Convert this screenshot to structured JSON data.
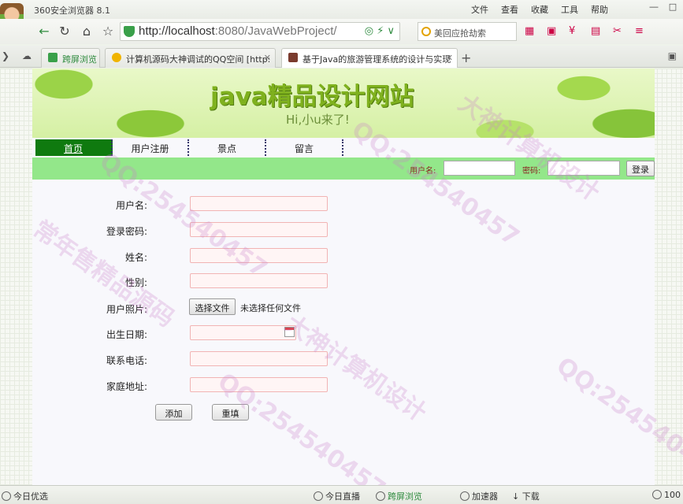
{
  "browser": {
    "title": "360安全浏览器 8.1",
    "menu": [
      "文件",
      "查看",
      "收藏",
      "工具",
      "帮助"
    ],
    "url_host": "http://localhost",
    "url_path": ":8080/JavaWebProject/",
    "search_placeholder": "美回应抢劫索",
    "tabs": [
      {
        "label": "跨屏浏览"
      },
      {
        "label": "计算机源码大神调试的QQ空间 [http:"
      },
      {
        "label": "基于Java的旅游管理系统的设计与实现"
      }
    ]
  },
  "site": {
    "title": "java精品设计网站",
    "subtitle": "Hi,小u来了!",
    "menu": [
      "首页",
      "用户注册",
      "景点",
      "留言"
    ],
    "login": {
      "user_label": "用户名:",
      "pass_label": "密码:",
      "button": "登录"
    }
  },
  "form": {
    "fields": [
      {
        "label": "用户名:"
      },
      {
        "label": "登录密码:"
      },
      {
        "label": "姓名:"
      },
      {
        "label": "性别:"
      },
      {
        "label": "用户照片:"
      },
      {
        "label": "出生日期:"
      },
      {
        "label": "联系电话:"
      },
      {
        "label": "家庭地址:"
      }
    ],
    "file_button": "选择文件",
    "file_status": "未选择任何文件",
    "add_button": "添加",
    "reset_button": "重填"
  },
  "statusbar": {
    "today": "今日优选",
    "live": "今日直播",
    "cross": "跨屏浏览",
    "accel": "加速器",
    "download": "下载",
    "zoom": "100"
  },
  "watermarks": [
    "QQ:254540457",
    "常年售精品源码",
    "大神计算机设计"
  ]
}
